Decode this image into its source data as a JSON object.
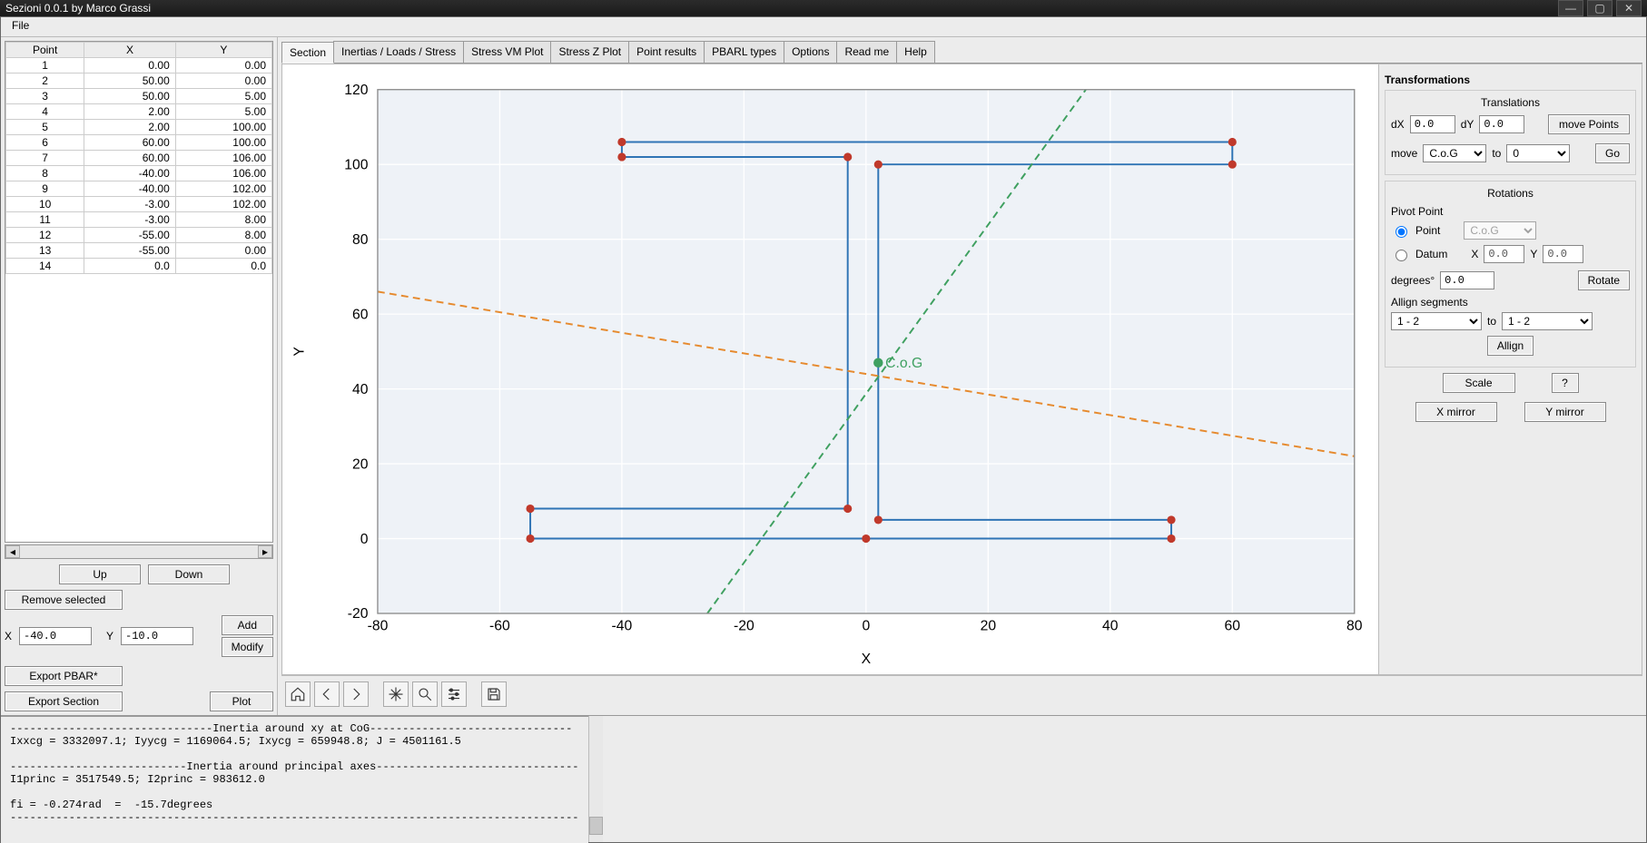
{
  "window": {
    "title": "Sezioni 0.0.1 by Marco Grassi"
  },
  "menu": {
    "file": "File"
  },
  "table": {
    "headers": {
      "point": "Point",
      "x": "X",
      "y": "Y"
    },
    "rows": [
      {
        "n": "1",
        "x": "0.00",
        "y": "0.00"
      },
      {
        "n": "2",
        "x": "50.00",
        "y": "0.00"
      },
      {
        "n": "3",
        "x": "50.00",
        "y": "5.00"
      },
      {
        "n": "4",
        "x": "2.00",
        "y": "5.00"
      },
      {
        "n": "5",
        "x": "2.00",
        "y": "100.00"
      },
      {
        "n": "6",
        "x": "60.00",
        "y": "100.00"
      },
      {
        "n": "7",
        "x": "60.00",
        "y": "106.00"
      },
      {
        "n": "8",
        "x": "-40.00",
        "y": "106.00"
      },
      {
        "n": "9",
        "x": "-40.00",
        "y": "102.00"
      },
      {
        "n": "10",
        "x": "-3.00",
        "y": "102.00"
      },
      {
        "n": "11",
        "x": "-3.00",
        "y": "8.00"
      },
      {
        "n": "12",
        "x": "-55.00",
        "y": "8.00"
      },
      {
        "n": "13",
        "x": "-55.00",
        "y": "0.00"
      },
      {
        "n": "14",
        "x": "0.0",
        "y": "0.0"
      }
    ]
  },
  "buttons": {
    "up": "Up",
    "down": "Down",
    "remove": "Remove selected",
    "add": "Add",
    "modify": "Modify",
    "exportPbar": "Export PBAR*",
    "exportSection": "Export Section",
    "plot": "Plot"
  },
  "xy": {
    "xLabel": "X",
    "xVal": "-40.0",
    "yLabel": "Y",
    "yVal": "-10.0"
  },
  "tabs": [
    "Section",
    "Inertias / Loads / Stress",
    "Stress VM Plot",
    "Stress Z Plot",
    "Point results",
    "PBARL types",
    "Options",
    "Read me",
    "Help"
  ],
  "transform": {
    "title": "Transformations",
    "translations": {
      "title": "Translations",
      "dx": "dX",
      "dxVal": "0.0",
      "dy": "dY",
      "dyVal": "0.0",
      "move": "move Points",
      "moveLbl": "move",
      "moveFromOpt": "C.o.G",
      "toLbl": "to",
      "moveToOpt": "0",
      "go": "Go"
    },
    "rotations": {
      "title": "Rotations",
      "pivot": "Pivot Point",
      "pointLbl": "Point",
      "pointOpt": "C.o.G",
      "datumLbl": "Datum",
      "xLbl": "X",
      "xVal": "0.0",
      "yLbl": "Y",
      "yVal": "0.0",
      "degLbl": "degrees°",
      "degVal": "0.0",
      "rotate": "Rotate",
      "allignSeg": "Allign segments",
      "seg1": "1 - 2",
      "toLbl": "to",
      "seg2": "1 - 2",
      "allign": "Allign"
    },
    "scale": "Scale",
    "help": "?",
    "xmirror": "X mirror",
    "ymirror": "Y mirror"
  },
  "plot": {
    "xlabel": "X",
    "ylabel": "Y",
    "cogLabel": "C.o.G"
  },
  "console_text": "-------------------------------Inertia around xy at CoG-------------------------------\nIxxcg = 3332097.1; Iyycg = 1169064.5; Ixycg = 659948.8; J = 4501161.5\n\n---------------------------Inertia around principal axes-------------------------------\nI1princ = 3517549.5; I2princ = 983612.0\n\nfi = -0.274rad  =  -15.7degrees\n---------------------------------------------------------------------------------------",
  "chart_data": {
    "type": "line",
    "title": "",
    "xlabel": "X",
    "ylabel": "Y",
    "xlim": [
      -80,
      80
    ],
    "ylim": [
      -20,
      120
    ],
    "xticks": [
      -80,
      -60,
      -40,
      -20,
      0,
      20,
      40,
      60,
      80
    ],
    "yticks": [
      -20,
      0,
      20,
      40,
      60,
      80,
      100,
      120
    ],
    "series": [
      {
        "name": "Section outline",
        "color": "#2f74b5",
        "values": [
          [
            0,
            0
          ],
          [
            50,
            0
          ],
          [
            50,
            5
          ],
          [
            2,
            5
          ],
          [
            2,
            100
          ],
          [
            60,
            100
          ],
          [
            60,
            106
          ],
          [
            -40,
            106
          ],
          [
            -40,
            102
          ],
          [
            -3,
            102
          ],
          [
            -3,
            8
          ],
          [
            -55,
            8
          ],
          [
            -55,
            0
          ],
          [
            0,
            0
          ]
        ]
      },
      {
        "name": "Principal axis 1",
        "color": "#e68a2e",
        "style": "dashed",
        "values": [
          [
            -80,
            66
          ],
          [
            80,
            22
          ]
        ]
      },
      {
        "name": "Principal axis 2",
        "color": "#3fa060",
        "style": "dashed",
        "values": [
          [
            -26,
            -20
          ],
          [
            36,
            120
          ]
        ]
      }
    ],
    "annotations": [
      {
        "text": "C.o.G",
        "x": 2,
        "y": 47,
        "color": "#3fa060"
      }
    ],
    "point_markers": {
      "color": "#c0392b",
      "points": [
        [
          0,
          0
        ],
        [
          50,
          0
        ],
        [
          50,
          5
        ],
        [
          2,
          5
        ],
        [
          2,
          100
        ],
        [
          60,
          100
        ],
        [
          60,
          106
        ],
        [
          -40,
          106
        ],
        [
          -40,
          102
        ],
        [
          -3,
          102
        ],
        [
          -3,
          8
        ],
        [
          -55,
          8
        ],
        [
          -55,
          0
        ]
      ]
    }
  }
}
